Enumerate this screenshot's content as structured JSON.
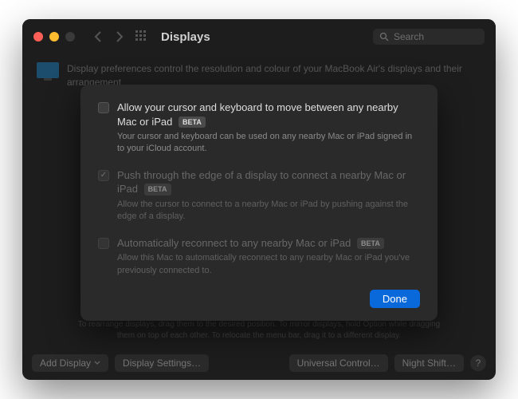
{
  "colors": {
    "accent": "#0a69da"
  },
  "titlebar": {
    "title": "Displays",
    "search_placeholder": "Search"
  },
  "header": {
    "description": "Display preferences control the resolution and colour of your MacBook Air's displays and their arrangement"
  },
  "modal": {
    "options": [
      {
        "title": "Allow your cursor and keyboard to move between any nearby Mac or iPad",
        "beta": "BETA",
        "desc": "Your cursor and keyboard can be used on any nearby Mac or iPad signed in to your iCloud account.",
        "checked": false,
        "enabled": true
      },
      {
        "title": "Push through the edge of a display to connect a nearby Mac or iPad",
        "beta": "BETA",
        "desc": "Allow the cursor to connect to a nearby Mac or iPad by pushing against the edge of a display.",
        "checked": true,
        "enabled": false
      },
      {
        "title": "Automatically reconnect to any nearby Mac or iPad",
        "beta": "BETA",
        "desc": "Allow this Mac to automatically reconnect to any nearby Mac or iPad you've previously connected to.",
        "checked": false,
        "enabled": false
      }
    ],
    "done": "Done"
  },
  "footer_hint": "To rearrange displays, drag them to the desired position. To mirror displays, hold Option while dragging them on top of each other. To relocate the menu bar, drag it to a different display.",
  "buttons": {
    "add_display": "Add Display",
    "display_settings": "Display Settings…",
    "universal_control": "Universal Control…",
    "night_shift": "Night Shift…",
    "help": "?"
  }
}
